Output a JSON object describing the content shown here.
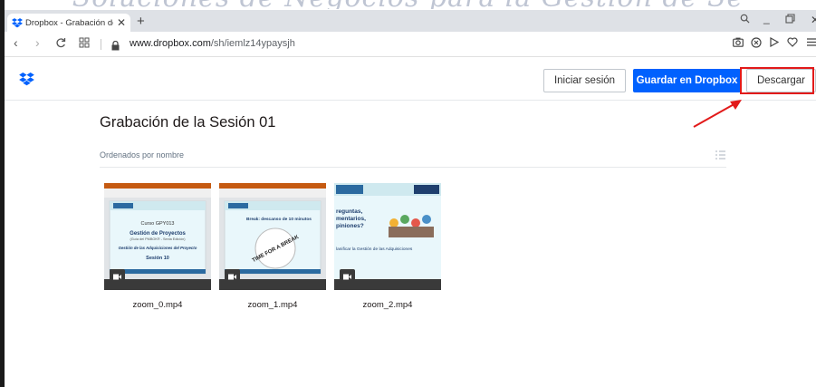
{
  "watermark": "Soluciones de Negocios para la Gestión de Se",
  "browser": {
    "tab_title": "Dropbox - Grabación de la",
    "url_host": "www.dropbox.com",
    "url_path": "/sh/iemlz14ypaysjh"
  },
  "header": {
    "login_label": "Iniciar sesión",
    "save_label": "Guardar en Dropbox",
    "download_label": "Descargar"
  },
  "folder": {
    "title": "Grabación de la Sesión 01",
    "sort_label": "Ordenados por nombre"
  },
  "files": [
    {
      "name": "zoom_0.mp4",
      "slide": {
        "course": "Curso GPY013",
        "title": "Gestión de Proyectos",
        "subtitle": "(Guía del PMBOK® - Sexta Edición)",
        "topic": "Gestión de las Adquisiciones del Proyecto",
        "session": "Sesión 10"
      }
    },
    {
      "name": "zoom_1.mp4",
      "slide": {
        "title": "Break: descanso de 10 minutos",
        "art": "TIME FOR A BREAK"
      }
    },
    {
      "name": "zoom_2.mp4",
      "slide": {
        "line1": "reguntas,",
        "line2": "mentarios,",
        "line3": "piniones?",
        "topic": "lanificar la Gestión de las Adquisiciones"
      }
    }
  ],
  "colors": {
    "accent": "#0061fe",
    "highlight": "#e21a1a"
  }
}
